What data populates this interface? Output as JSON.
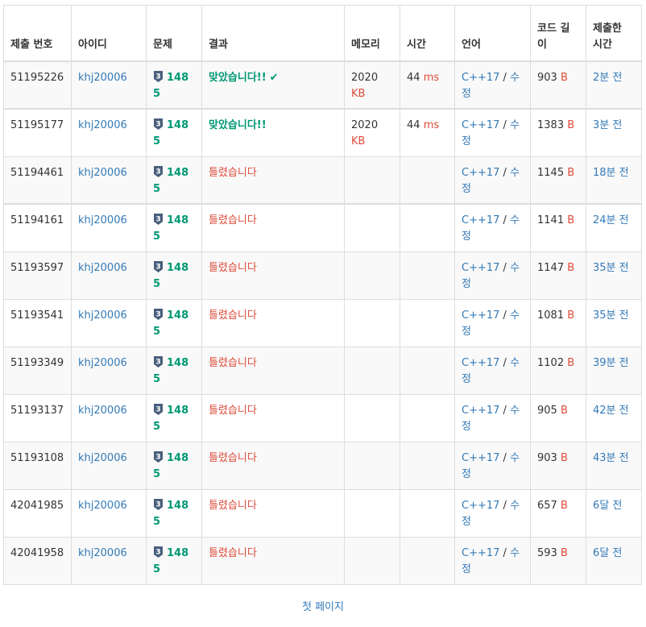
{
  "headers": {
    "id": "제출 번호",
    "user": "아이디",
    "problem": "문제",
    "result": "결과",
    "memory": "메모리",
    "time": "시간",
    "language": "언어",
    "length": "코드 길이",
    "submitted": "제출한 시간"
  },
  "units": {
    "memory": "KB",
    "time": "ms",
    "length": "B"
  },
  "colors": {
    "link": "#337ab7",
    "accepted": "#009874",
    "wrong": "#dd4b39",
    "tier_badge": "#4a5f7c"
  },
  "tier_icon": "silver-3-tier-icon",
  "tier_label": "3",
  "rows": [
    {
      "id": "51195226",
      "user": "khj20006",
      "problem": "1485",
      "result": "맞았습니다!!",
      "accepted": true,
      "check": "✔",
      "memory": "2020",
      "time": "44",
      "lang": "C++17",
      "edit": "수정",
      "length": "903",
      "submitted": "2분 전"
    },
    {
      "id": "51195177",
      "user": "khj20006",
      "problem": "1485",
      "result": "맞았습니다!!",
      "accepted": true,
      "check": "",
      "memory": "2020",
      "time": "44",
      "lang": "C++17",
      "edit": "수정",
      "length": "1383",
      "submitted": "3분 전"
    },
    {
      "id": "51194461",
      "user": "khj20006",
      "problem": "1485",
      "result": "틀렸습니다",
      "accepted": false,
      "memory": "",
      "time": "",
      "lang": "C++17",
      "edit": "수정",
      "length": "1145",
      "submitted": "18분 전"
    },
    {
      "id": "51194161",
      "user": "khj20006",
      "problem": "1485",
      "result": "틀렸습니다",
      "accepted": false,
      "memory": "",
      "time": "",
      "lang": "C++17",
      "edit": "수정",
      "length": "1141",
      "submitted": "24분 전"
    },
    {
      "id": "51193597",
      "user": "khj20006",
      "problem": "1485",
      "result": "틀렸습니다",
      "accepted": false,
      "memory": "",
      "time": "",
      "lang": "C++17",
      "edit": "수정",
      "length": "1147",
      "submitted": "35분 전"
    },
    {
      "id": "51193541",
      "user": "khj20006",
      "problem": "1485",
      "result": "틀렸습니다",
      "accepted": false,
      "memory": "",
      "time": "",
      "lang": "C++17",
      "edit": "수정",
      "length": "1081",
      "submitted": "35분 전"
    },
    {
      "id": "51193349",
      "user": "khj20006",
      "problem": "1485",
      "result": "틀렸습니다",
      "accepted": false,
      "memory": "",
      "time": "",
      "lang": "C++17",
      "edit": "수정",
      "length": "1102",
      "submitted": "39분 전"
    },
    {
      "id": "51193137",
      "user": "khj20006",
      "problem": "1485",
      "result": "틀렸습니다",
      "accepted": false,
      "memory": "",
      "time": "",
      "lang": "C++17",
      "edit": "수정",
      "length": "905",
      "submitted": "42분 전"
    },
    {
      "id": "51193108",
      "user": "khj20006",
      "problem": "1485",
      "result": "틀렸습니다",
      "accepted": false,
      "memory": "",
      "time": "",
      "lang": "C++17",
      "edit": "수정",
      "length": "903",
      "submitted": "43분 전"
    },
    {
      "id": "42041985",
      "user": "khj20006",
      "problem": "1485",
      "result": "틀렸습니다",
      "accepted": false,
      "memory": "",
      "time": "",
      "lang": "C++17",
      "edit": "수정",
      "length": "657",
      "submitted": "6달 전"
    },
    {
      "id": "42041958",
      "user": "khj20006",
      "problem": "1485",
      "result": "틀렸습니다",
      "accepted": false,
      "memory": "",
      "time": "",
      "lang": "C++17",
      "edit": "수정",
      "length": "593",
      "submitted": "6달 전"
    }
  ],
  "pagination": {
    "first_page": "첫 페이지"
  }
}
